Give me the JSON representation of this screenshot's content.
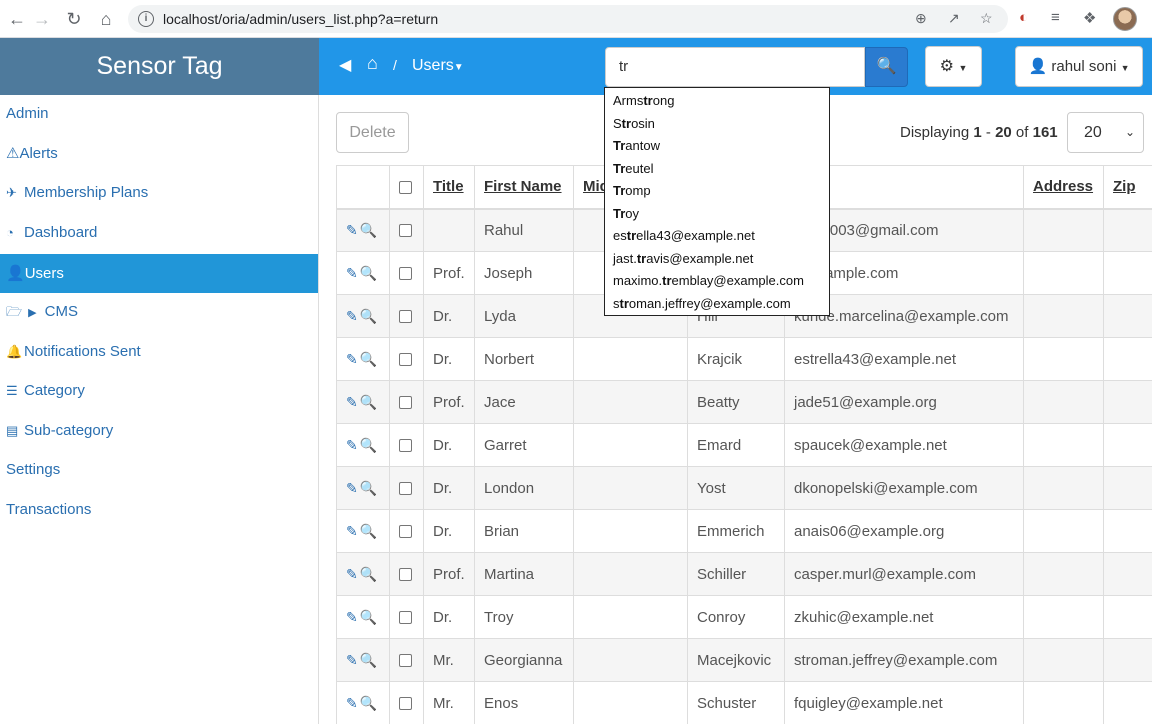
{
  "browser": {
    "url": "localhost/oria/admin/users_list.php?a=return"
  },
  "brand": "Sensor Tag",
  "sidebar": {
    "items": [
      {
        "label": "Admin",
        "icon": ""
      },
      {
        "label": "Alerts",
        "icon": "warning-icon"
      },
      {
        "label": "Membership Plans",
        "icon": "plane-icon"
      },
      {
        "label": "Dashboard",
        "icon": "dashboard-icon"
      },
      {
        "label": "Users",
        "icon": "user-icon",
        "active": true
      },
      {
        "label": "CMS",
        "icon": "folder-open-icon"
      },
      {
        "label": "Notifications Sent",
        "icon": "bell-icon"
      },
      {
        "label": "Category",
        "icon": "list-icon"
      },
      {
        "label": "Sub-category",
        "icon": "list-alt-icon"
      },
      {
        "label": "Settings",
        "icon": ""
      },
      {
        "label": "Transactions",
        "icon": ""
      }
    ]
  },
  "header": {
    "breadcrumb_sep": "/",
    "breadcrumb_current": "Users",
    "search_value": "tr",
    "user_name": "rahul soni"
  },
  "toolbar": {
    "delete_label": "Delete",
    "displaying_prefix": "Displaying",
    "range_start": "1",
    "range_sep": "-",
    "range_end": "20",
    "of_label": "of",
    "total": "161",
    "page_size": "20"
  },
  "table": {
    "columns": [
      "Title",
      "First Name",
      "Mid",
      "l",
      "Address",
      "Zip"
    ],
    "rows": [
      {
        "title": "",
        "first": "Rahul",
        "last": "",
        "email": "soni2003@gmail.com"
      },
      {
        "title": "Prof.",
        "first": "Joseph",
        "last": "",
        "email": "@example.com"
      },
      {
        "title": "Dr.",
        "first": "Lyda",
        "last": "Hill",
        "email": "kunde.marcelina@example.com"
      },
      {
        "title": "Dr.",
        "first": "Norbert",
        "last": "Krajcik",
        "email": "estrella43@example.net"
      },
      {
        "title": "Prof.",
        "first": "Jace",
        "last": "Beatty",
        "email": "jade51@example.org"
      },
      {
        "title": "Dr.",
        "first": "Garret",
        "last": "Emard",
        "email": "spaucek@example.net"
      },
      {
        "title": "Dr.",
        "first": "London",
        "last": "Yost",
        "email": "dkonopelski@example.com"
      },
      {
        "title": "Dr.",
        "first": "Brian",
        "last": "Emmerich",
        "email": "anais06@example.org"
      },
      {
        "title": "Prof.",
        "first": "Martina",
        "last": "Schiller",
        "email": "casper.murl@example.com"
      },
      {
        "title": "Dr.",
        "first": "Troy",
        "last": "Conroy",
        "email": "zkuhic@example.net"
      },
      {
        "title": "Mr.",
        "first": "Georgianna",
        "last": "Macejkovic",
        "email": "stroman.jeffrey@example.com"
      },
      {
        "title": "Mr.",
        "first": "Enos",
        "last": "Schuster",
        "email": "fquigley@example.net"
      }
    ]
  },
  "autocomplete": [
    {
      "pre": "Arms",
      "match": "tr",
      "post": "ong"
    },
    {
      "pre": "S",
      "match": "tr",
      "post": "osin"
    },
    {
      "pre": "",
      "match": "Tr",
      "post": "antow"
    },
    {
      "pre": "",
      "match": "Tr",
      "post": "eutel"
    },
    {
      "pre": "",
      "match": "Tr",
      "post": "omp"
    },
    {
      "pre": "",
      "match": "Tr",
      "post": "oy"
    },
    {
      "pre": "es",
      "match": "tr",
      "post": "ella43@example.net"
    },
    {
      "pre": "jast.",
      "match": "tr",
      "post": "avis@example.net"
    },
    {
      "pre": "maximo.",
      "match": "tr",
      "post": "emblay@example.com"
    },
    {
      "pre": "s",
      "match": "tr",
      "post": "oman.jeffrey@example.com"
    }
  ]
}
